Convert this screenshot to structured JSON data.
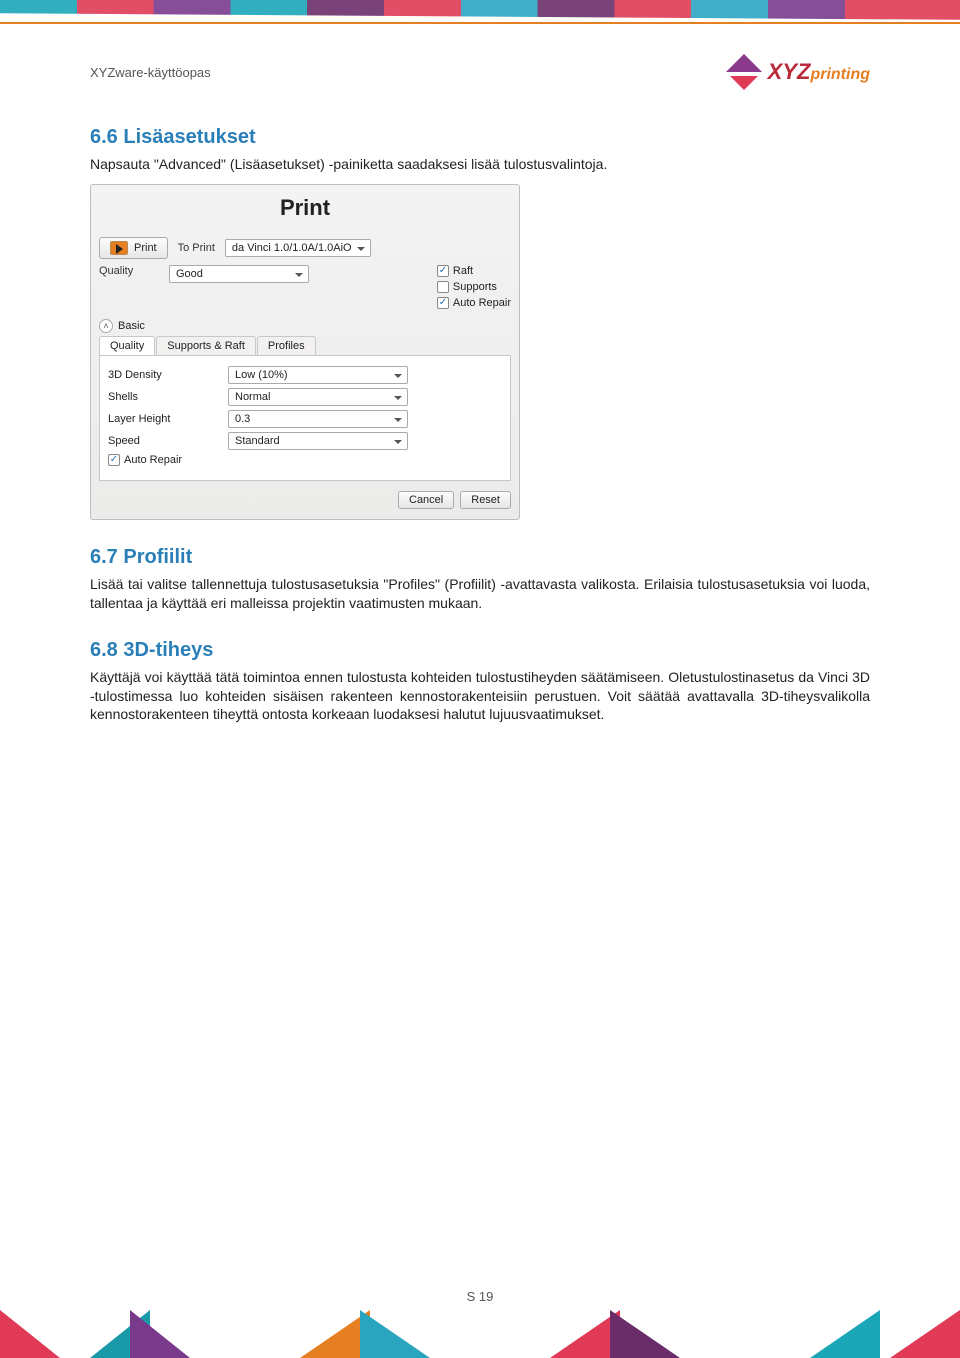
{
  "header": {
    "doc_title": "XYZware-käyttöopas",
    "logo_text_main": "XYZ",
    "logo_text_suffix": "printing"
  },
  "sections": {
    "s66": {
      "title": "6.6 Lisäasetukset",
      "body": "Napsauta \"Advanced\" (Lisäasetukset) -painiketta saadaksesi lisää tulostusvalintoja."
    },
    "s67": {
      "title": "6.7 Profiilit",
      "body": "Lisää tai valitse tallennettuja tulostusasetuksia \"Profiles\" (Profiilit) -avattavasta valikosta. Erilaisia tulostusasetuksia voi luoda, tallentaa ja käyttää eri malleissa projektin vaatimusten mukaan."
    },
    "s68": {
      "title": "6.8 3D-tiheys",
      "body": "Käyttäjä voi käyttää tätä toimintoa ennen tulostusta kohteiden tulostustiheyden säätämiseen. Oletustulostinasetus da Vinci 3D -tulostimessa luo kohteiden sisäisen rakenteen kennostorakenteisiin perustuen. Voit säätää avattavalla 3D-tiheysvalikolla kennostorakenteen tiheyttä ontosta korkeaan luodaksesi halutut lujuusvaatimukset."
    }
  },
  "dialog": {
    "title": "Print",
    "print_btn": "Print",
    "to_print_label": "To Print",
    "to_print_value": "da Vinci 1.0/1.0A/1.0AiO",
    "quality_label": "Quality",
    "quality_value": "Good",
    "raft_label": "Raft",
    "raft_checked": true,
    "supports_label": "Supports",
    "supports_checked": false,
    "autorepair_label": "Auto Repair",
    "autorepair_checked": true,
    "basic_label": "Basic",
    "tabs": {
      "quality": "Quality",
      "supports_raft": "Supports & Raft",
      "profiles": "Profiles"
    },
    "rows": {
      "density_label": "3D Density",
      "density_value": "Low (10%)",
      "shells_label": "Shells",
      "shells_value": "Normal",
      "layer_label": "Layer Height",
      "layer_value": "0.3",
      "speed_label": "Speed",
      "speed_value": "Standard"
    },
    "inner_autorepair_label": "Auto Repair",
    "inner_autorepair_checked": true,
    "cancel": "Cancel",
    "reset": "Reset"
  },
  "page_number": "S 19"
}
